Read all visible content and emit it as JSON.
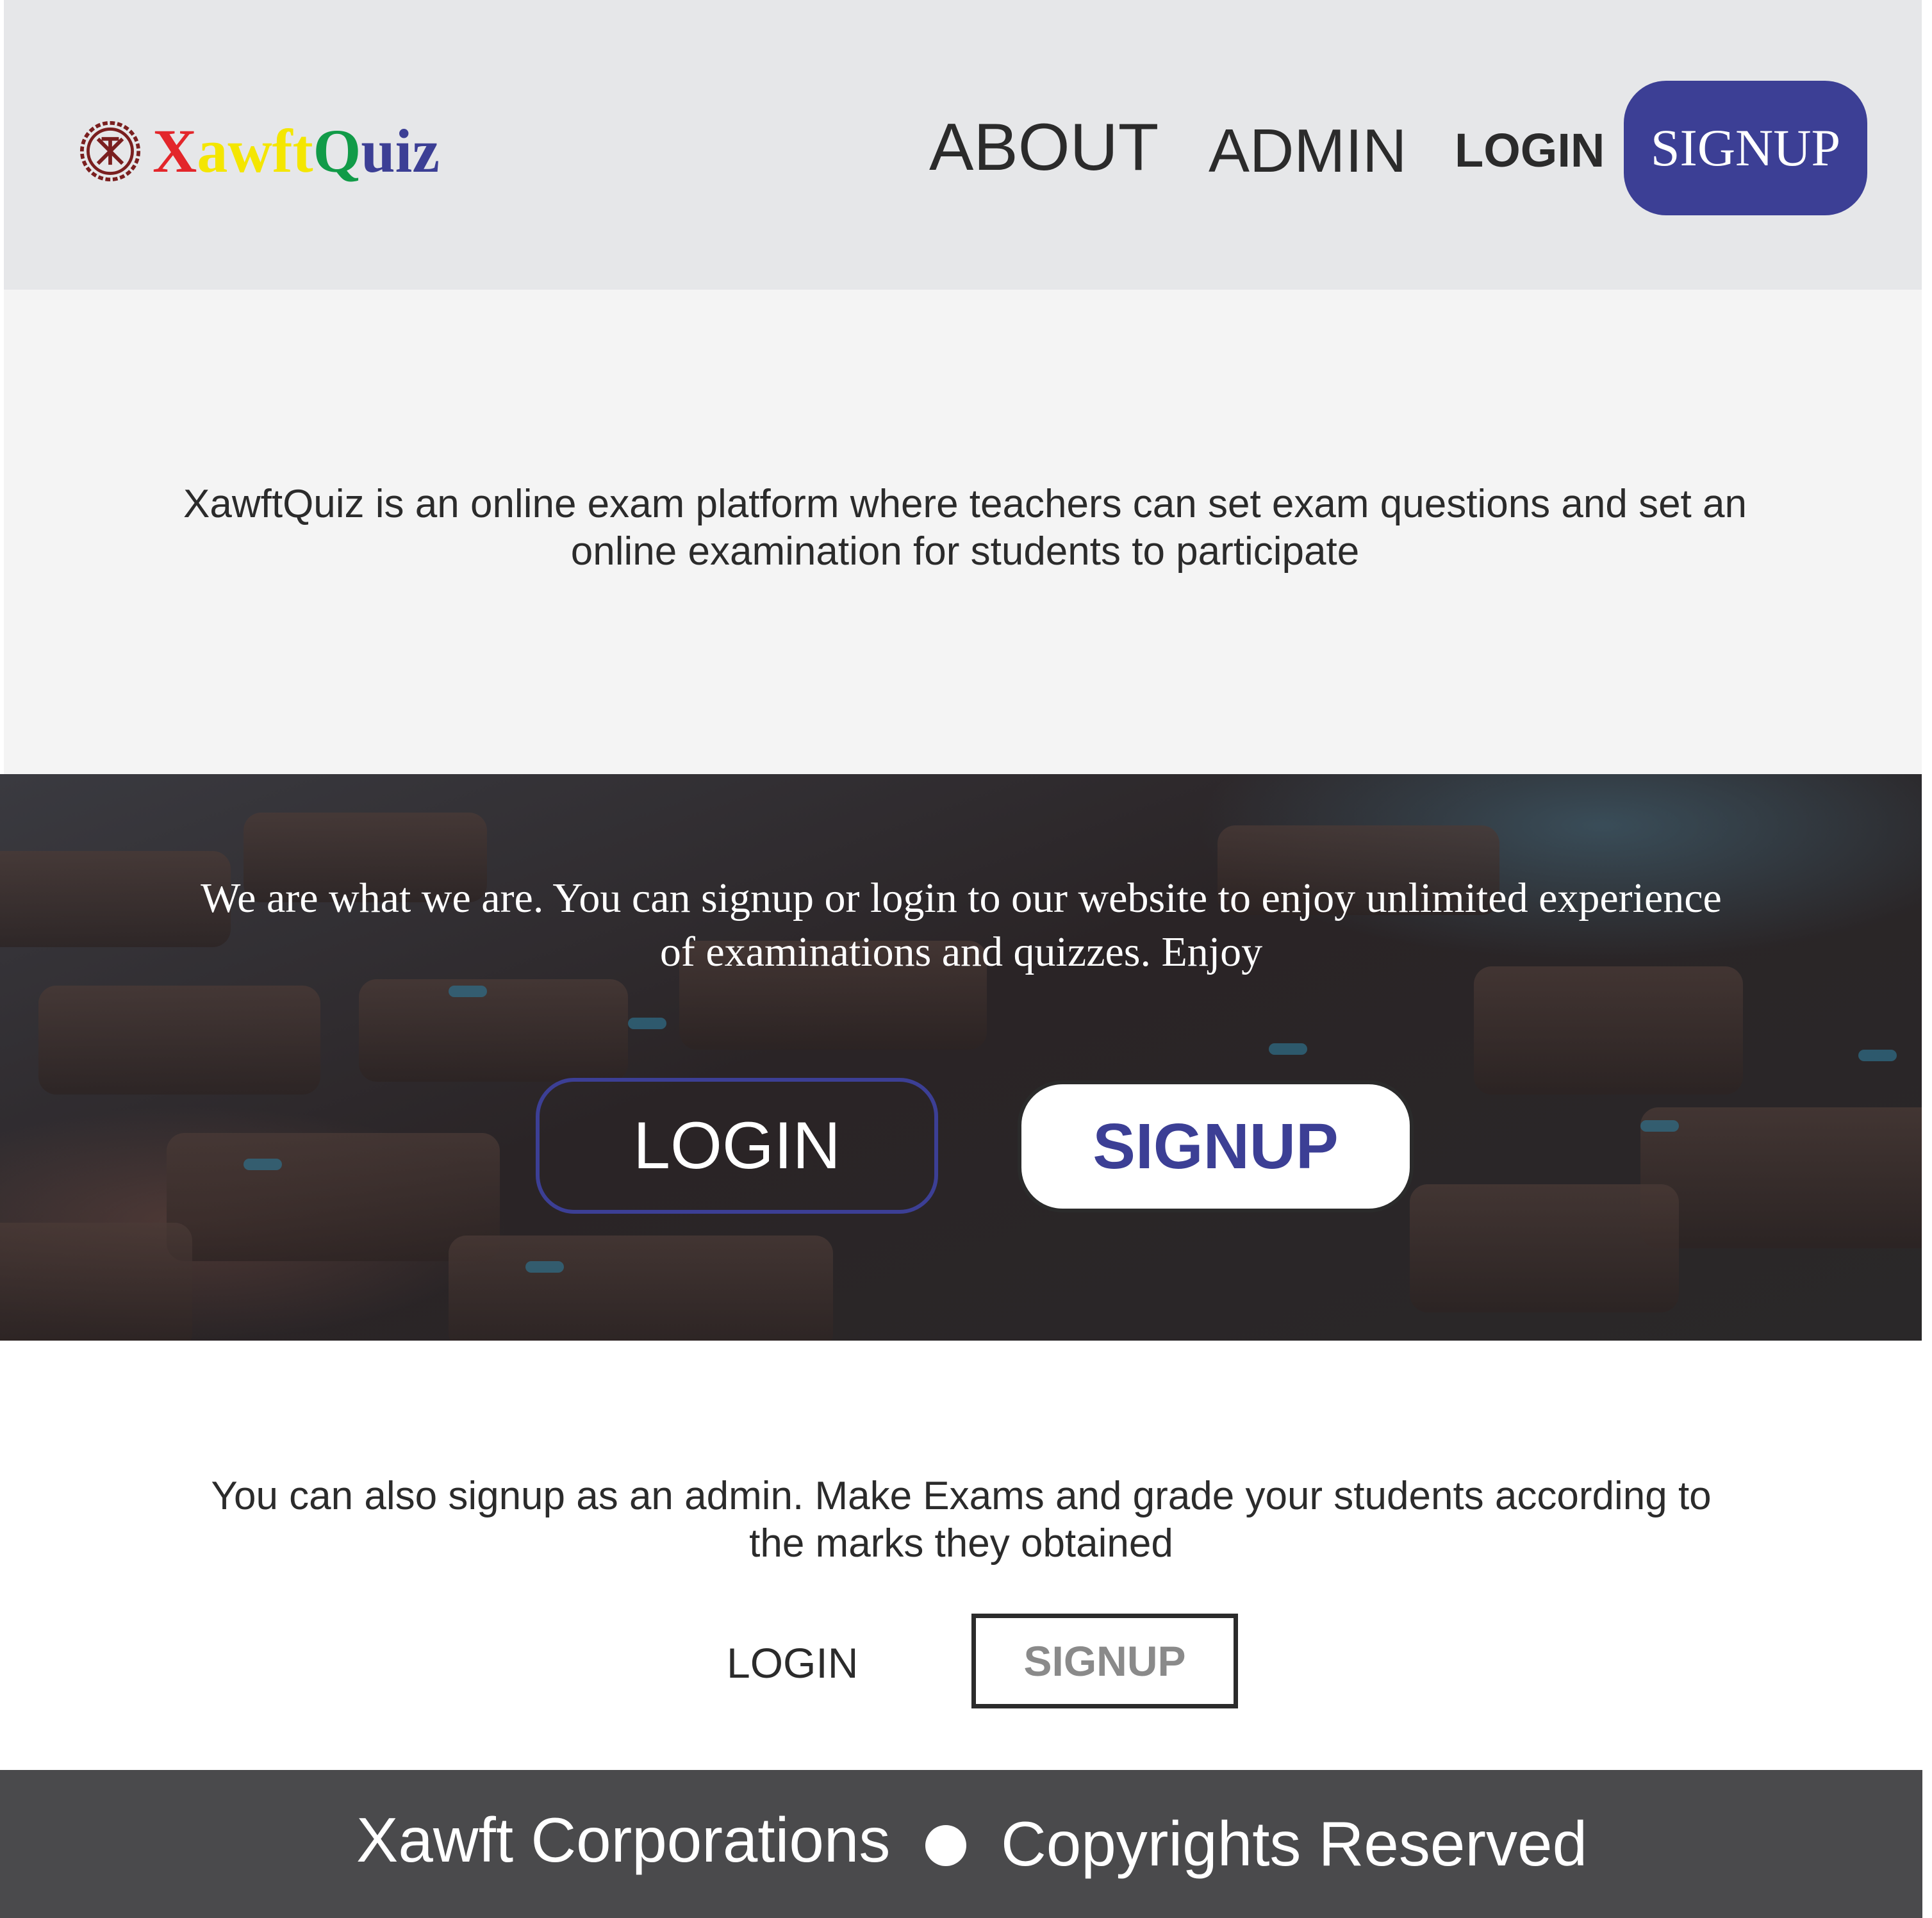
{
  "header": {
    "logo": {
      "letters": [
        {
          "char": "X",
          "color": "#e3262b"
        },
        {
          "char": "a",
          "color": "#f4e600"
        },
        {
          "char": "w",
          "color": "#f4e600"
        },
        {
          "char": "f",
          "color": "#f4e600"
        },
        {
          "char": "t",
          "color": "#f4e600"
        },
        {
          "char": "Q",
          "color": "#119b48"
        },
        {
          "char": "u",
          "color": "#3c3f95"
        },
        {
          "char": "i",
          "color": "#3c3f95"
        },
        {
          "char": "z",
          "color": "#3c3f95"
        }
      ],
      "mark_icon": "xt-emblem-icon",
      "mark_color": "#7a1f1f"
    },
    "nav": {
      "about": "ABOUT",
      "admin": "ADMIN",
      "login": "LOGIN",
      "signup": "SIGNUP"
    }
  },
  "intro": {
    "text": "XawftQuiz is an online exam platform where teachers can set exam questions and set an online examination for students to participate"
  },
  "hero": {
    "text": "We are what we are. You can signup or login to our website to enjoy unlimited experience of examinations and quizzes. Enjoy",
    "login": "LOGIN",
    "signup": "SIGNUP"
  },
  "admin_section": {
    "text": "You can also signup as an admin. Make Exams and grade your students according to the marks they obtained",
    "login": "LOGIN",
    "signup": "SIGNUP"
  },
  "footer": {
    "left": "Xawft Corporations",
    "right": "Copyrights Reserved"
  },
  "colors": {
    "brand": "#3c3f95",
    "header_bg": "#e6e7e9",
    "intro_bg": "#f4f4f4",
    "footer_bg": "#4a4a4c"
  }
}
